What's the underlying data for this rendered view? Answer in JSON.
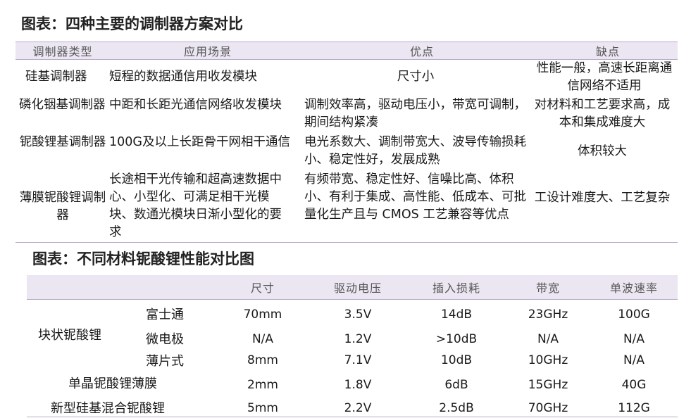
{
  "table1": {
    "title": "图表：四种主要的调制器方案对比",
    "headers": [
      "调制器类型",
      "应用场景",
      "优点",
      "缺点"
    ],
    "rows": [
      [
        "硅基调制器",
        "短程的数据通信用收发模块",
        "尺寸小",
        "性能一般，高速长距离通信网络不适用"
      ],
      [
        "磷化铟基调制器",
        "中距和长距光通信网络收发模块",
        "调制效率高，驱动电压小，带宽可调制，期间结构紧凑",
        "对材料和工艺要求高，成本和集成难度大"
      ],
      [
        "铌酸锂基调制器",
        "100G及以上长距骨干网相干通信",
        "电光系数大、调制带宽大、波导传输损耗小、稳定性好，发展成熟",
        "体积较大"
      ],
      [
        "薄膜铌酸锂调制器",
        "长途相干光传输和超高速数据中心、小型化、可满足相干光模块、数通光模块日渐小型化的要求",
        "有频带宽、稳定性好、信噪比高、体积小、有利于集成、高性能、低成本、可批量化生产且与 CMOS 工艺兼容等优点",
        "工设计难度大、工艺复杂"
      ]
    ]
  },
  "table2": {
    "title": "图表：不同材料铌酸锂性能对比图",
    "headers": [
      "尺寸",
      "驱动电压",
      "插入损耗",
      "带宽",
      "单波速率"
    ],
    "group_label": "块状铌酸锂",
    "rows": [
      {
        "label": "富士通",
        "values": [
          "70mm",
          "3.5V",
          "14dB",
          "23GHz",
          "100G"
        ]
      },
      {
        "label": "微电极",
        "values": [
          "N/A",
          "1.2V",
          ">10dB",
          "N/A",
          "N/A"
        ]
      },
      {
        "label": "薄片式",
        "values": [
          "8mm",
          "7.1V",
          "10dB",
          "10GHz",
          "N/A"
        ]
      },
      {
        "label": "单晶铌酸锂薄膜",
        "values": [
          "2mm",
          "1.8V",
          "6dB",
          "15GHz",
          "40G"
        ]
      },
      {
        "label": "新型硅基混合铌酸锂",
        "values": [
          "5mm",
          "2.2V",
          "2.5dB",
          "70GHz",
          "112G"
        ]
      }
    ]
  }
}
